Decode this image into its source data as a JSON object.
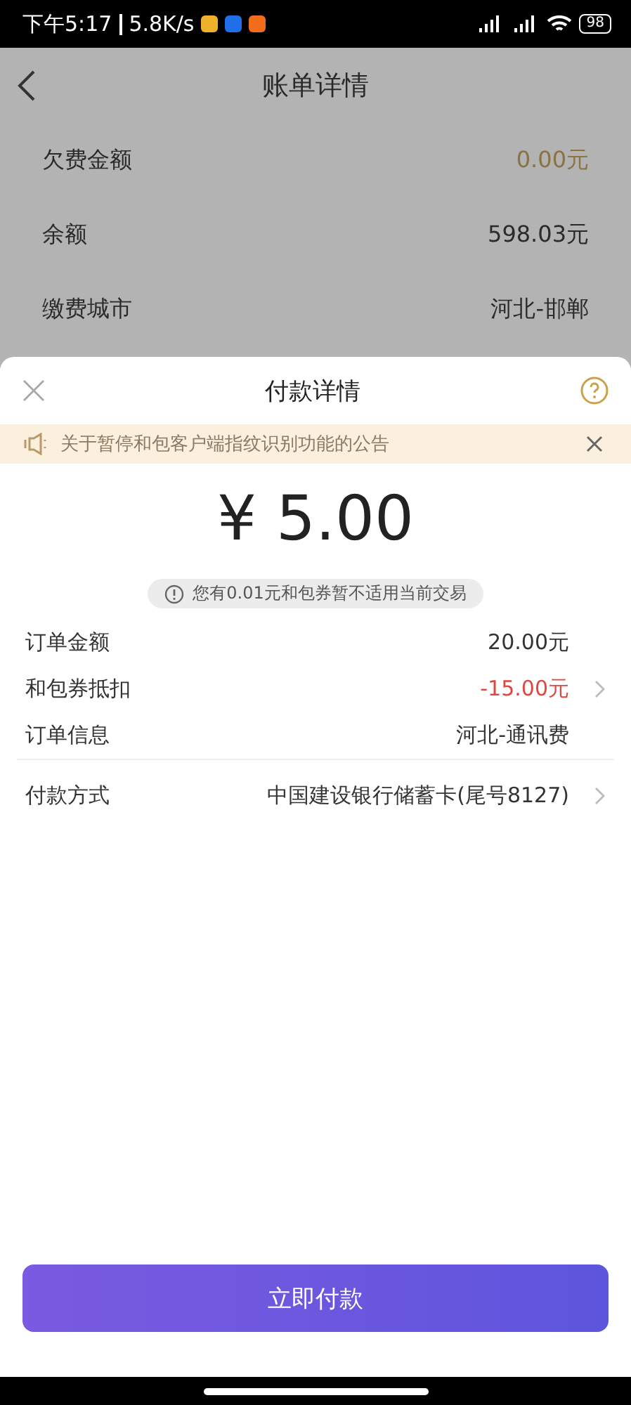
{
  "status_bar": {
    "time": "下午5:17",
    "speed": "5.8K/s",
    "battery": "98"
  },
  "header": {
    "title": "账单详情"
  },
  "bill_rows": [
    {
      "label": "欠费金额",
      "value": "0.00元",
      "kind": "highlight"
    },
    {
      "label": "余额",
      "value": "598.03元",
      "kind": "plain"
    },
    {
      "label": "缴费城市",
      "value": "河北-邯郸",
      "kind": "plain"
    }
  ],
  "sheet": {
    "title": "付款详情",
    "notice": "关于暂停和包客户端指纹识别功能的公告",
    "amount": "¥ 5.00",
    "tip": "您有0.01元和包券暂不适用当前交易",
    "rows": [
      {
        "label": "订单金额",
        "value": "20.00元",
        "kind": "plain",
        "arrow": false
      },
      {
        "label": "和包券抵扣",
        "value": "-15.00元",
        "kind": "discount",
        "arrow": true
      },
      {
        "label": "订单信息",
        "value": "河北-通讯费",
        "kind": "plain",
        "arrow": false
      }
    ],
    "payment": {
      "label": "付款方式",
      "value": "中国建设银行储蓄卡(尾号8127)",
      "arrow": true
    },
    "button": "立即付款"
  }
}
